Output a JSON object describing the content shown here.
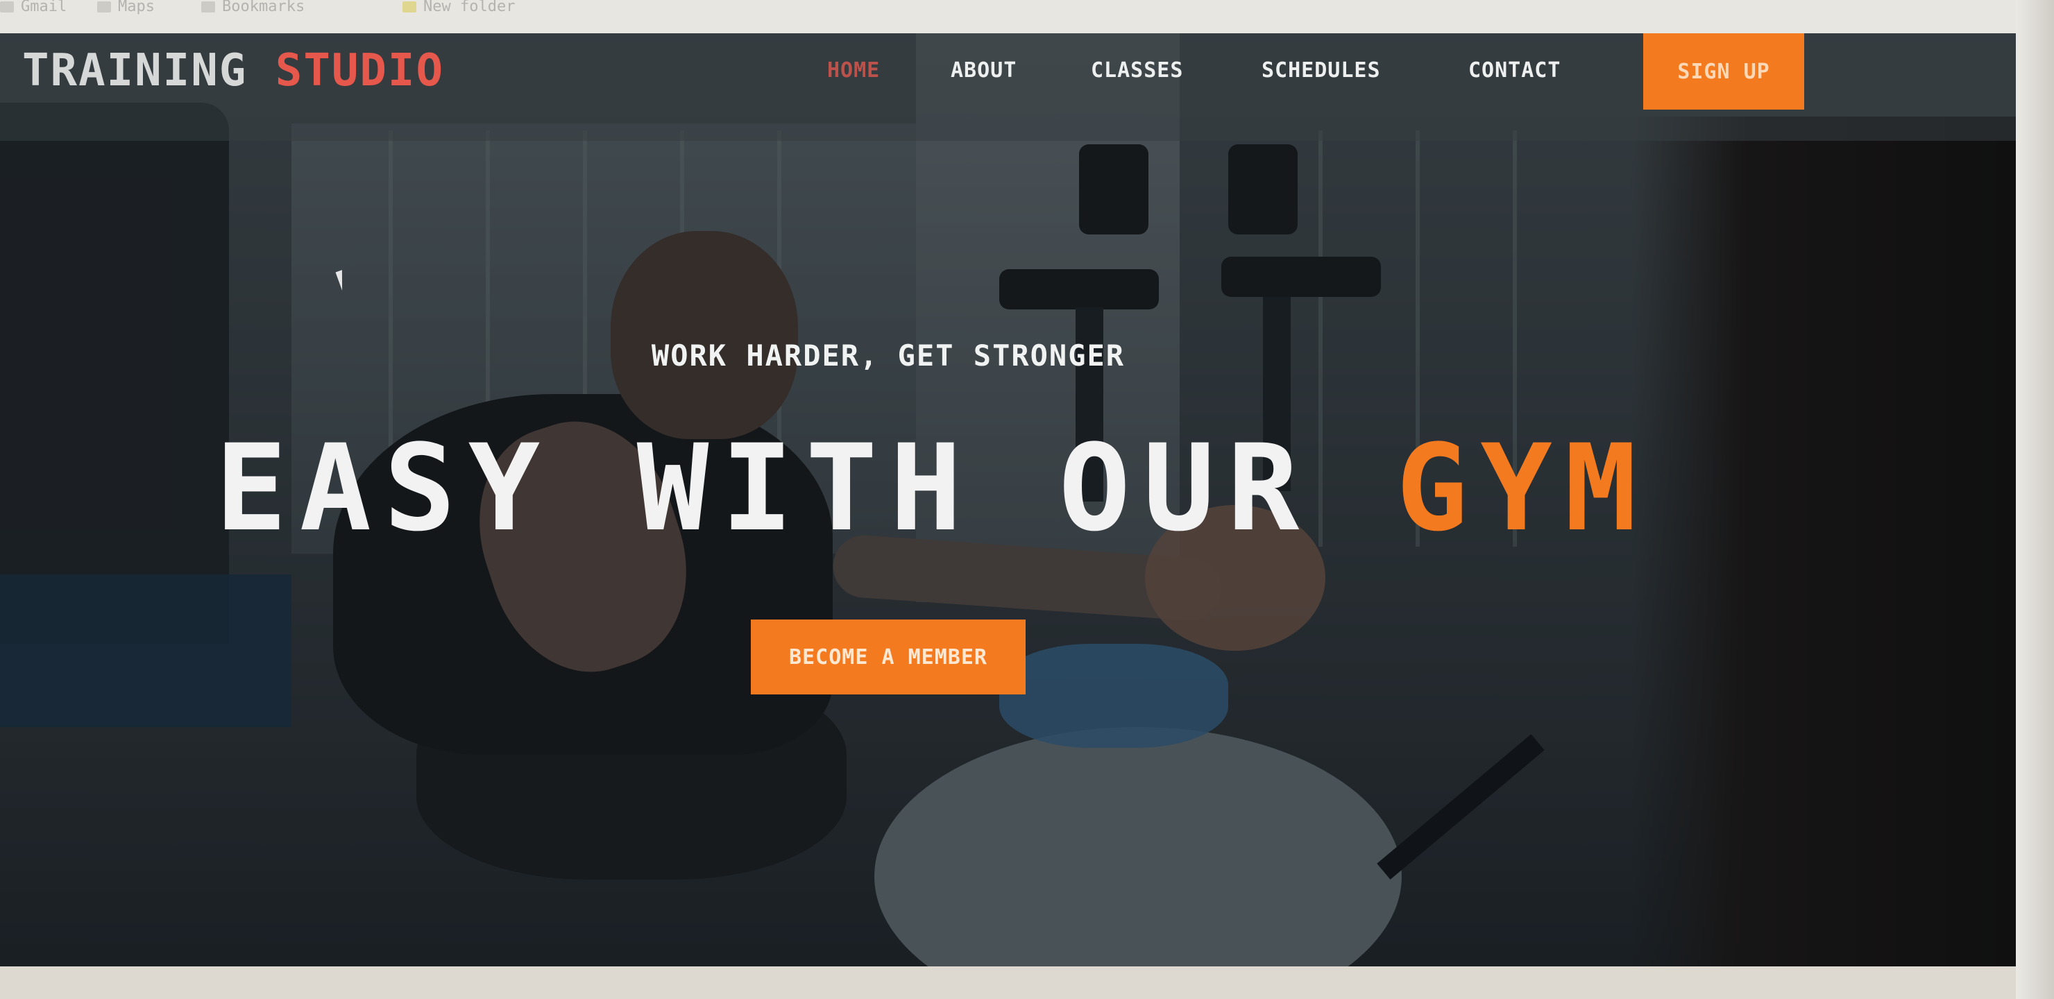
{
  "bookmarks": [
    {
      "label": "Gmail",
      "icon": "bookmark-icon"
    },
    {
      "label": "Maps",
      "icon": "map-icon"
    },
    {
      "label": "Bookmarks",
      "icon": "bookmark-icon"
    },
    {
      "label": "New folder",
      "icon": "folder-icon"
    }
  ],
  "site": {
    "logo_primary": "TRAINING",
    "logo_accent": "STUDIO",
    "nav": [
      "HOME",
      "ABOUT",
      "CLASSES",
      "SCHEDULES",
      "CONTACT"
    ],
    "active_nav": "HOME",
    "signup_label": "SIGN UP"
  },
  "hero": {
    "subtitle": "WORK HARDER, GET STRONGER",
    "title_main": "EASY WITH OUR",
    "title_accent": "GYM",
    "cta_label": "BECOME A MEMBER"
  },
  "colors": {
    "accent": "#f47a20",
    "logo_accent": "#e5584b",
    "text": "#f2f2f2"
  }
}
